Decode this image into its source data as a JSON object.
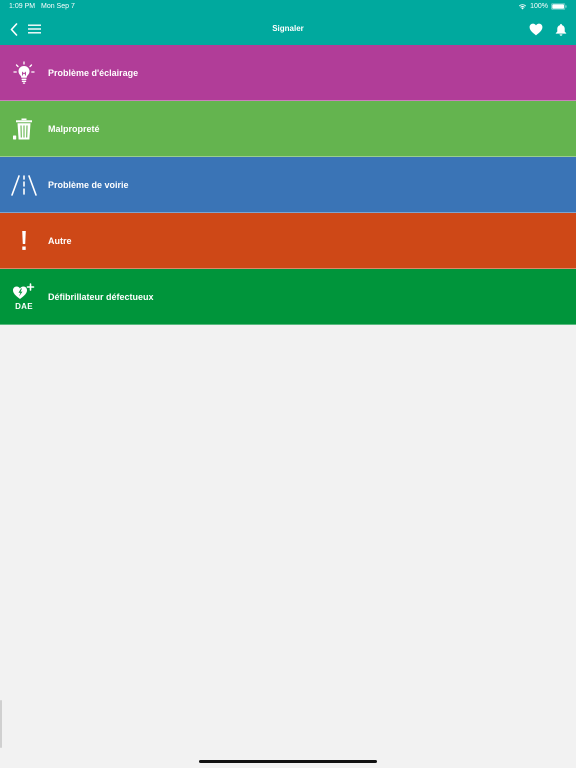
{
  "status_bar": {
    "time": "1:09 PM",
    "date": "Mon Sep 7",
    "battery": "100%"
  },
  "nav": {
    "title": "Signaler"
  },
  "colors": {
    "header": "#00a99e",
    "background": "#f2f2f2"
  },
  "items": [
    {
      "label": "Problème d'éclairage",
      "icon": "lightbulb-icon",
      "color": "#b13d98"
    },
    {
      "label": "Malpropreté",
      "icon": "trash-can-icon",
      "color": "#64b44f"
    },
    {
      "label": "Problème de voirie",
      "icon": "road-icon",
      "color": "#3a74b6"
    },
    {
      "label": "Autre",
      "icon": "exclamation-icon",
      "color": "#ce4817"
    },
    {
      "label": "Défibrillateur défectueux",
      "icon": "defibrillator-icon",
      "icon_text": "DAE",
      "color": "#00953b"
    }
  ]
}
